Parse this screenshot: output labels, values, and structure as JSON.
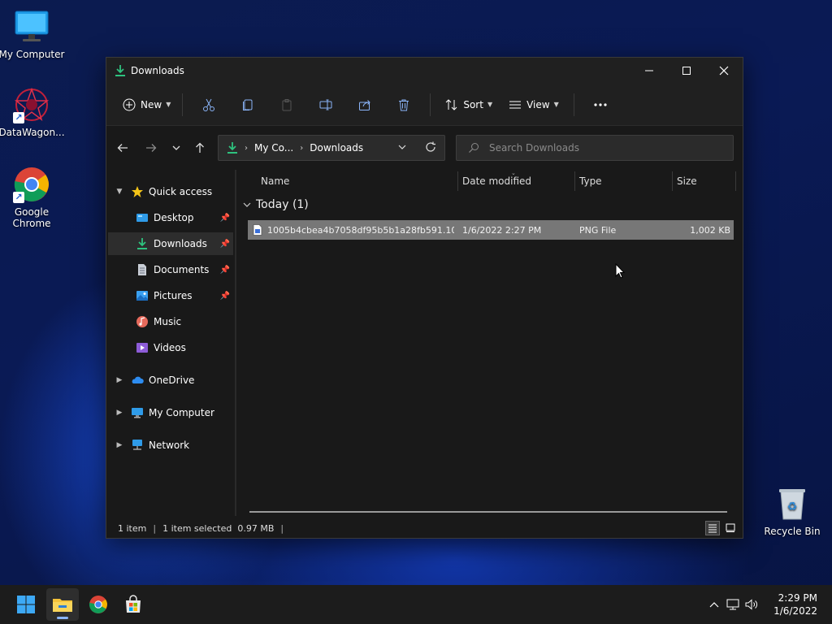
{
  "desktop": {
    "icons": [
      {
        "label": "My Computer"
      },
      {
        "label": "DataWagon..."
      },
      {
        "label": "Google Chrome"
      },
      {
        "label": "Recycle Bin"
      }
    ]
  },
  "window": {
    "title": "Downloads",
    "toolbar": {
      "new_label": "New",
      "sort_label": "Sort",
      "view_label": "View"
    },
    "address": {
      "crumbs": [
        "My Co...",
        "Downloads"
      ]
    },
    "search": {
      "placeholder": "Search Downloads"
    },
    "sidebar": {
      "items": [
        {
          "label": "Quick access"
        },
        {
          "label": "Desktop"
        },
        {
          "label": "Downloads"
        },
        {
          "label": "Documents"
        },
        {
          "label": "Pictures"
        },
        {
          "label": "Music"
        },
        {
          "label": "Videos"
        },
        {
          "label": "OneDrive"
        },
        {
          "label": "My Computer"
        },
        {
          "label": "Network"
        }
      ]
    },
    "columns": [
      "Name",
      "Date modified",
      "Type",
      "Size"
    ],
    "group": {
      "label": "Today (1)"
    },
    "files": [
      {
        "name": "1005b4cbea4b7058df95b5b1a28fb591.100...",
        "date": "1/6/2022 2:27 PM",
        "type": "PNG File",
        "size": "1,002 KB"
      }
    ],
    "status": {
      "count": "1 item",
      "selected": "1 item selected  0.97 MB"
    }
  },
  "taskbar": {
    "time": "2:29 PM",
    "date": "1/6/2022"
  }
}
